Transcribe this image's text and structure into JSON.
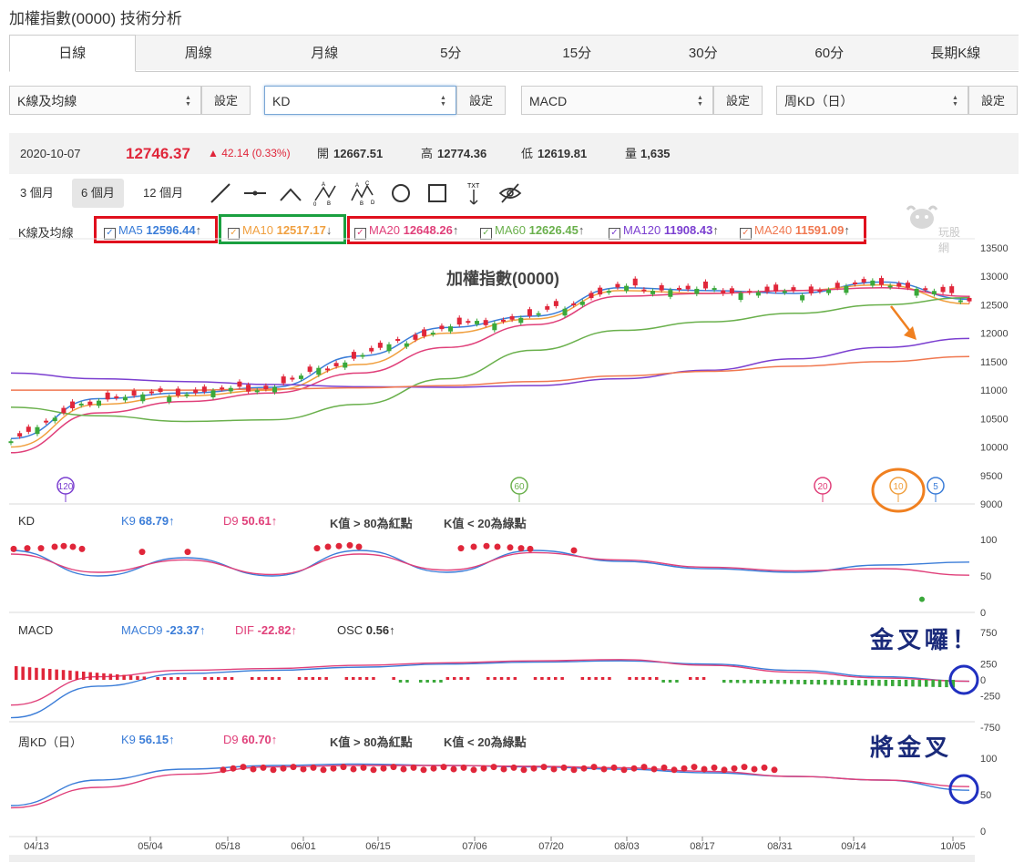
{
  "page": {
    "title": "加權指數(0000) 技術分析"
  },
  "tabs": [
    "日線",
    "周線",
    "月線",
    "5分",
    "15分",
    "30分",
    "60分",
    "長期K線"
  ],
  "selectors": [
    {
      "value": "K線及均線",
      "button": "設定"
    },
    {
      "value": "KD",
      "button": "設定"
    },
    {
      "value": "MACD",
      "button": "設定"
    },
    {
      "value": "周KD（日）",
      "button": "設定"
    }
  ],
  "quote": {
    "date": "2020-10-07",
    "price": "12746.37",
    "change": "▲ 42.14 (0.33%)",
    "open_label": "開",
    "open": "12667.51",
    "high_label": "高",
    "high": "12774.36",
    "low_label": "低",
    "low": "12619.81",
    "vol_label": "量",
    "vol": "1,635"
  },
  "ranges": [
    "3 個月",
    "6 個月",
    "12 個月"
  ],
  "tools": [
    "line-tool-icon",
    "hline-tool-icon",
    "wedge-tool-icon",
    "abc-pattern-icon",
    "abcd-pattern-icon",
    "circle-tool-icon",
    "rect-tool-icon",
    "text-tool-icon",
    "hide-tool-icon"
  ],
  "tool_labels": {
    "a": "A",
    "b": "B",
    "c": "C",
    "d": "D",
    "zero": "0",
    "txt": "TXT"
  },
  "watermark": "玩股網",
  "ma_legend": {
    "label": "K線及均線",
    "items": [
      {
        "name": "MA5",
        "value": "12596.44",
        "arrow": "↑",
        "color": "#3b7dd8"
      },
      {
        "name": "MA10",
        "value": "12517.17",
        "arrow": "↓",
        "color": "#f0a040"
      },
      {
        "name": "MA20",
        "value": "12648.26",
        "arrow": "↑",
        "color": "#e0407a"
      },
      {
        "name": "MA60",
        "value": "12626.45",
        "arrow": "↑",
        "color": "#6ab04c"
      },
      {
        "name": "MA120",
        "value": "11908.43",
        "arrow": "↑",
        "color": "#7b3fd0"
      },
      {
        "name": "MA240",
        "value": "11591.09",
        "arrow": "↑",
        "color": "#f07850"
      }
    ],
    "checkmark": "✓"
  },
  "price_panel": {
    "title": "加權指數(0000)",
    "yticks": [
      "13500",
      "13000",
      "12500",
      "12000",
      "11500",
      "11000",
      "10500",
      "10000",
      "9500",
      "9000"
    ],
    "markers": [
      "120",
      "60",
      "20",
      "10",
      "5"
    ]
  },
  "kd_panel": {
    "label": "KD",
    "k_name": "K9",
    "k_value": "68.79",
    "k_arrow": "↑",
    "d_name": "D9",
    "d_value": "50.61",
    "d_arrow": "↑",
    "rule1": "K值 > 80為紅點",
    "rule2": "K值 < 20為綠點",
    "yticks": [
      "100",
      "50",
      "0"
    ]
  },
  "macd_panel": {
    "label": "MACD",
    "macd_name": "MACD9",
    "macd_value": "-23.37",
    "macd_arrow": "↑",
    "dif_name": "DIF",
    "dif_value": "-22.82",
    "dif_arrow": "↑",
    "osc_name": "OSC",
    "osc_value": "0.56",
    "osc_arrow": "↑",
    "yticks": [
      "750",
      "250",
      "0",
      "-250",
      "-750"
    ]
  },
  "wkd_panel": {
    "label": "周KD（日）",
    "k_name": "K9",
    "k_value": "56.15",
    "k_arrow": "↑",
    "d_name": "D9",
    "d_value": "60.70",
    "d_arrow": "↑",
    "rule1": "K值 > 80為紅點",
    "rule2": "K值 < 20為綠點",
    "yticks": [
      "100",
      "50",
      "0"
    ]
  },
  "xticks": [
    "04/13",
    "05/04",
    "05/18",
    "06/01",
    "06/15",
    "07/06",
    "07/20",
    "08/03",
    "08/17",
    "08/31",
    "09/14",
    "10/05"
  ],
  "annotations": {
    "macd_note": "金叉囉！",
    "wkd_note": "將金叉"
  },
  "colors": {
    "up": "#e0263a",
    "down": "#3aa83a",
    "k": "#3b7dd8",
    "d": "#e0407a",
    "box_red": "#e0101e",
    "box_green": "#1aa040",
    "arrow_orange": "#f08020",
    "circle_blue": "#2030c0"
  },
  "chart_data": [
    {
      "type": "line",
      "title": "加權指數(0000)",
      "x": [
        "04/13",
        "05/04",
        "05/18",
        "06/01",
        "06/15",
        "07/06",
        "07/20",
        "08/03",
        "08/17",
        "08/31",
        "09/14",
        "10/05"
      ],
      "series": [
        {
          "name": "MA5",
          "values": [
            10150,
            10850,
            10950,
            11050,
            11600,
            12100,
            12300,
            12800,
            12750,
            12700,
            12900,
            12596
          ]
        },
        {
          "name": "MA10",
          "values": [
            10000,
            10750,
            10900,
            11000,
            11450,
            12000,
            12250,
            12750,
            12700,
            12750,
            12850,
            12517
          ]
        },
        {
          "name": "MA20",
          "values": [
            9900,
            10600,
            10800,
            10950,
            11300,
            11750,
            12150,
            12650,
            12700,
            12750,
            12800,
            12648
          ]
        },
        {
          "name": "MA60",
          "values": [
            10700,
            10550,
            10450,
            10480,
            10750,
            11200,
            11700,
            12050,
            12200,
            12350,
            12500,
            12626
          ]
        },
        {
          "name": "MA120",
          "values": [
            11300,
            11200,
            11150,
            11100,
            11060,
            11050,
            11080,
            11200,
            11350,
            11550,
            11750,
            11908
          ]
        },
        {
          "name": "MA240",
          "values": [
            11000,
            11000,
            11000,
            11020,
            11040,
            11080,
            11150,
            11250,
            11330,
            11420,
            11500,
            11591
          ]
        }
      ],
      "ylim": [
        9000,
        13500
      ]
    },
    {
      "type": "line",
      "title": "KD",
      "x": [
        "04/13",
        "05/04",
        "05/18",
        "06/01",
        "06/15",
        "07/06",
        "07/20",
        "08/03",
        "08/17",
        "08/31",
        "09/14",
        "10/05"
      ],
      "series": [
        {
          "name": "K9",
          "values": [
            85,
            50,
            75,
            50,
            85,
            55,
            85,
            70,
            60,
            55,
            65,
            69
          ]
        },
        {
          "name": "D9",
          "values": [
            80,
            55,
            72,
            52,
            80,
            58,
            82,
            72,
            62,
            57,
            60,
            51
          ]
        }
      ],
      "ylim": [
        0,
        100
      ]
    },
    {
      "type": "line",
      "title": "MACD",
      "x": [
        "04/13",
        "05/04",
        "05/18",
        "06/01",
        "06/15",
        "07/06",
        "07/20",
        "08/03",
        "08/17",
        "08/31",
        "09/14",
        "10/05"
      ],
      "series": [
        {
          "name": "MACD9",
          "values": [
            -600,
            -100,
            100,
            150,
            200,
            250,
            280,
            300,
            250,
            150,
            50,
            -23
          ]
        },
        {
          "name": "DIF",
          "values": [
            -400,
            50,
            150,
            180,
            230,
            270,
            300,
            320,
            230,
            120,
            30,
            -23
          ]
        }
      ],
      "ylim": [
        -750,
        750
      ]
    },
    {
      "type": "line",
      "title": "周KD（日）",
      "x": [
        "04/13",
        "05/04",
        "05/18",
        "06/01",
        "06/15",
        "07/06",
        "07/20",
        "08/03",
        "08/17",
        "08/31",
        "09/14",
        "10/05"
      ],
      "series": [
        {
          "name": "K9",
          "values": [
            35,
            70,
            85,
            90,
            92,
            90,
            88,
            85,
            80,
            75,
            70,
            56
          ]
        },
        {
          "name": "D9",
          "values": [
            32,
            60,
            78,
            88,
            90,
            90,
            89,
            87,
            82,
            75,
            70,
            61
          ]
        }
      ],
      "ylim": [
        0,
        100
      ]
    }
  ]
}
